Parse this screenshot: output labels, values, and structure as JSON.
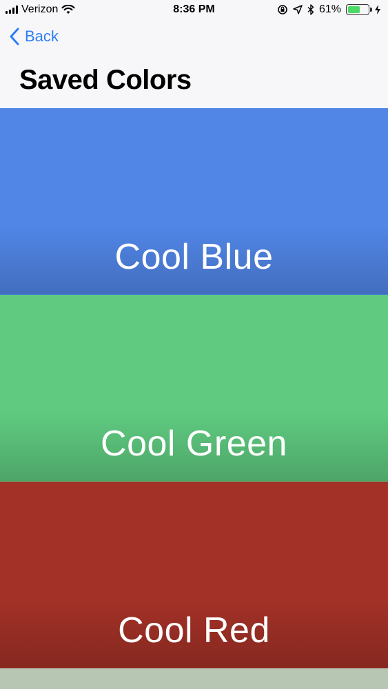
{
  "status_bar": {
    "carrier": "Verizon",
    "time": "8:36 PM",
    "battery_percent_label": "61%",
    "battery_level": 0.61,
    "icons": [
      "signal-icon",
      "wifi-icon",
      "rotation-lock-icon",
      "location-icon",
      "bluetooth-icon",
      "battery-icon",
      "charging-icon"
    ]
  },
  "nav": {
    "back_label": "Back",
    "title": "Saved Colors",
    "accent_color": "#2f7ef6"
  },
  "colors": [
    {
      "name": "Cool Blue",
      "color": "#5186e7"
    },
    {
      "name": "Cool Green",
      "color": "#5fca80"
    },
    {
      "name": "Cool Red",
      "color": "#a33127"
    }
  ],
  "partial_next_color": "#b7c5b3"
}
